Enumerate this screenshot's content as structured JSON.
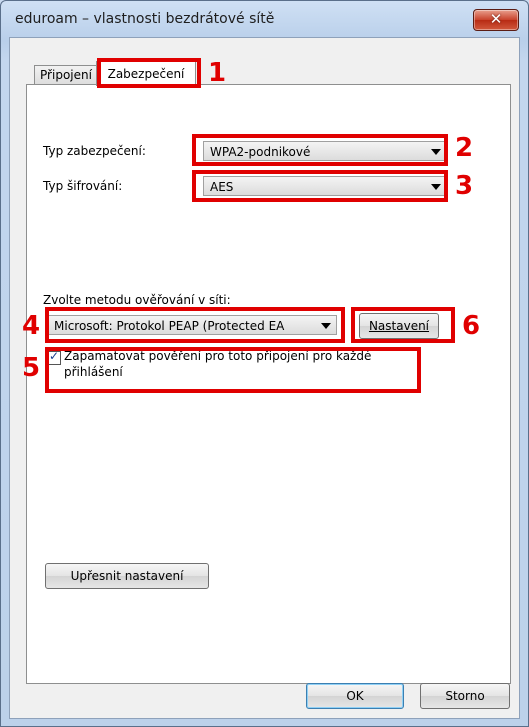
{
  "window": {
    "title": "eduroam – vlastnosti bezdrátové sítě",
    "close_label": "✕"
  },
  "tabs": [
    {
      "label": "Připojení",
      "active": false
    },
    {
      "label": "Zabezpečení",
      "active": true
    }
  ],
  "security": {
    "type_label": "Typ zabezpečení:",
    "type_value": "WPA2-podnikové",
    "encryption_label": "Typ šifrování:",
    "encryption_value": "AES"
  },
  "auth": {
    "method_label": "Zvolte metodu ověřování v síti:",
    "method_value": "Microsoft: Protokol PEAP (Protected EA",
    "settings_button": "Nastavení",
    "remember_label_line1": "Zapamatovat pověření pro toto připojení pro každé",
    "remember_label_line2": "přihlášení",
    "remember_checked": true
  },
  "advanced_button": "Upřesnit nastavení",
  "footer": {
    "ok": "OK",
    "cancel": "Storno"
  },
  "annotations": [
    "1",
    "2",
    "3",
    "4",
    "5",
    "6"
  ],
  "colors": {
    "annotation_red": "#e00000"
  }
}
